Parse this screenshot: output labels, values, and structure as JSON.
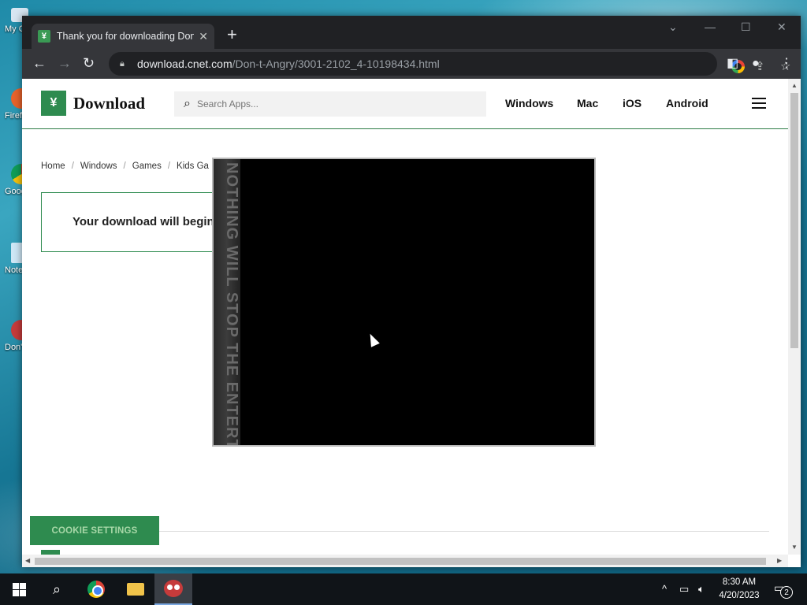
{
  "desktop": {
    "icons": [
      {
        "label": "My Computer"
      },
      {
        "label": "Firefox"
      },
      {
        "label": "Google Chrome"
      },
      {
        "label": "Notepad"
      },
      {
        "label": "Don't Get Angry"
      }
    ]
  },
  "browser": {
    "tab_title": "Thank you for downloading Don't Get Angry",
    "tab_close": "✕",
    "new_tab": "+",
    "url_host": "download.cnet.com",
    "url_path": "/Don-t-Angry/3001-2102_4-10198434.html"
  },
  "site": {
    "logo_text": "Download",
    "search_placeholder": "Search Apps...",
    "nav": [
      "Windows",
      "Mac",
      "iOS",
      "Android"
    ],
    "breadcrumbs": [
      "Home",
      "Windows",
      "Games",
      "Kids Ga"
    ],
    "download_message": "Your download will begin",
    "cookie_button": "COOKIE SETTINGS"
  },
  "overlay": {
    "strip_text": "NOTHING WILL STOP THE ENTERTAINMENT"
  },
  "taskbar": {
    "time": "8:30 AM",
    "date": "4/20/2023",
    "notification_count": "2"
  },
  "colors": {
    "brand_green": "#2e8b4f",
    "chrome_dark": "#202124"
  }
}
